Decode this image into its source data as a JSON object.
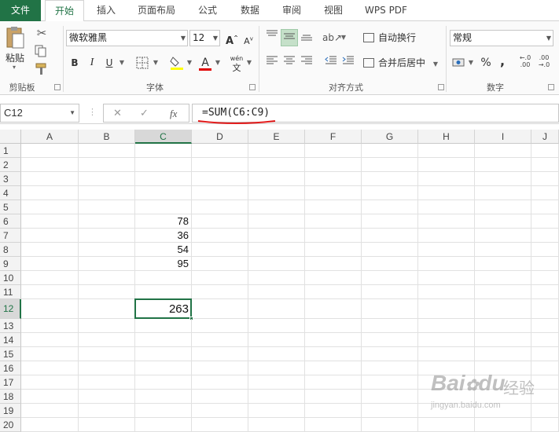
{
  "tabs": {
    "file": "文件",
    "home": "开始",
    "insert": "插入",
    "page_layout": "页面布局",
    "formulas": "公式",
    "data": "数据",
    "review": "审阅",
    "view": "视图",
    "wps_pdf": "WPS PDF"
  },
  "ribbon": {
    "paste_label": "粘贴",
    "clipboard_group": "剪贴板",
    "font_name": "微软雅黑",
    "font_size": "12",
    "font_group": "字体",
    "bold": "B",
    "italic": "I",
    "underline": "U",
    "wen_top": "wén",
    "wen_bottom": "文",
    "wrap_text": "自动换行",
    "merge_center": "合并后居中",
    "alignment_group": "对齐方式",
    "number_format": "常规",
    "percent": "%",
    "comma": ",",
    "inc_decimal": "←.0\n.00",
    "dec_decimal": ".00\n→.0",
    "number_group": "数字",
    "accent_color": "#217346"
  },
  "formula_bar": {
    "name_box": "C12",
    "formula": "=SUM(C6:C9)",
    "cancel": "✕",
    "enter": "✓",
    "fx": "fx"
  },
  "columns": [
    "A",
    "B",
    "C",
    "D",
    "E",
    "F",
    "G",
    "H",
    "I",
    "J"
  ],
  "rows": [
    "1",
    "2",
    "3",
    "4",
    "5",
    "6",
    "7",
    "8",
    "9",
    "10",
    "11",
    "12",
    "13",
    "14",
    "15",
    "16",
    "17",
    "18",
    "19",
    "20"
  ],
  "cells": {
    "C6": "78",
    "C7": "36",
    "C8": "54",
    "C9": "95",
    "C12": "263"
  },
  "watermark": {
    "brand": "Bai",
    "brand2": "du",
    "jingyan": "经验",
    "url": "jingyan.baidu.com"
  }
}
